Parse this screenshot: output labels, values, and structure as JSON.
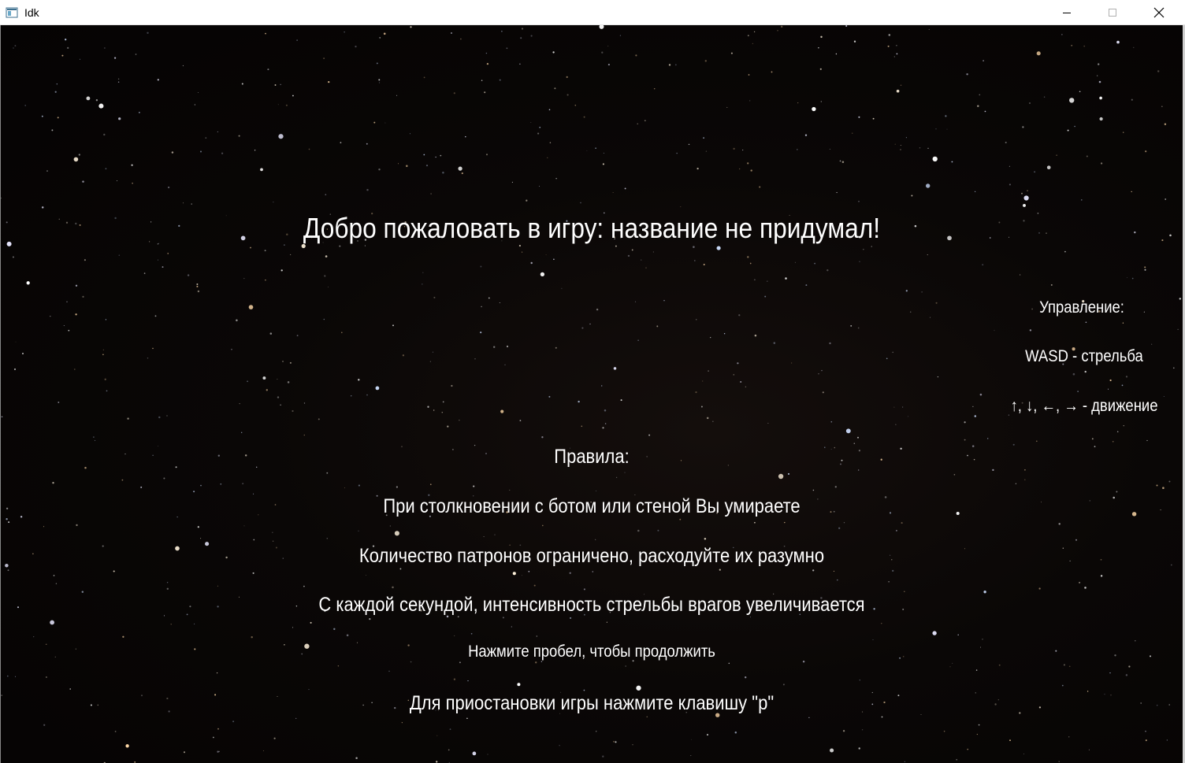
{
  "window": {
    "title": "Idk",
    "icon": "window-app-icon",
    "controls": [
      "minimize-icon",
      "maximize-icon",
      "close-icon"
    ]
  },
  "colors": {
    "background": "#000000",
    "text": "#ffffff",
    "titlebar": "#ffffff"
  },
  "screen": {
    "welcome": "Добро пожаловать в игру: название не придумал!",
    "controls": {
      "heading": "Управление:",
      "shoot": "WASD - стрельба",
      "move": "↑, ↓, ←, → - движение"
    },
    "rules": {
      "heading": "Правила:",
      "items": [
        "При столкновении с ботом или стеной Вы умираете",
        "Количество патронов ограничено, расходуйте их разумно",
        "С каждой секундой, интенсивность стрельбы врагов увеличивается"
      ]
    },
    "continue_hint": "Нажмите пробел, чтобы продолжить",
    "pause_hint": "Для приостановки игры нажмите клавишу \"p\""
  }
}
